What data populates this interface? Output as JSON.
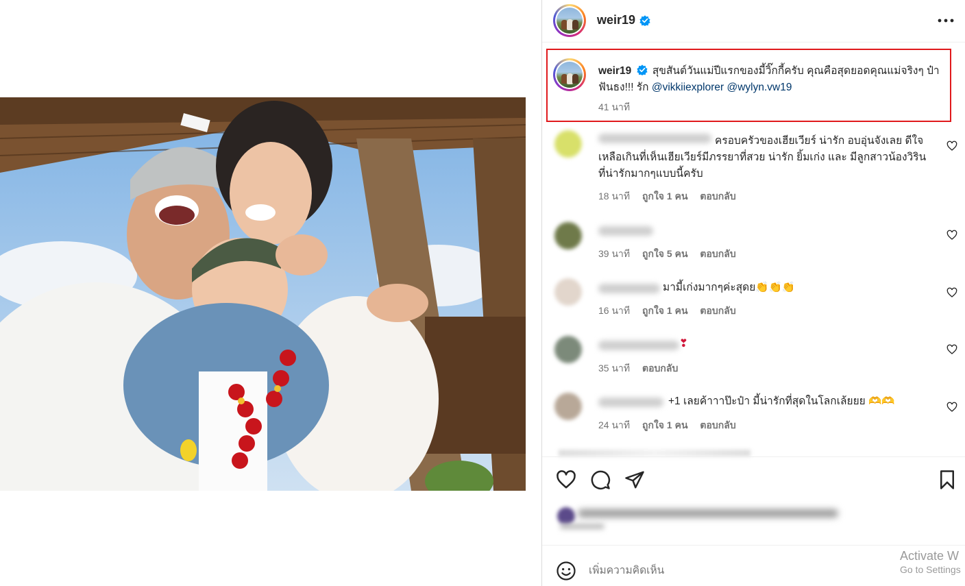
{
  "post": {
    "username": "weir19",
    "verified": true,
    "caption": {
      "username": "weir19",
      "text": "สุขสันต์วันแม่ปีแรกของมี้วิ๊กกี้ครับ คุณคือสุดยอดคุณแม่จริงๆ ป๋าฟันธง!!! รัก",
      "mentions": [
        "@vikkiiexplorer",
        "@wylyn.vw19"
      ],
      "time": "41 นาที"
    }
  },
  "comments": [
    {
      "text": "ครอบครัวของเฮียเวียร์ น่ารัก อบอุ่นจังเลย ดีใจเหลือเกินที่เห็นเฮียเวียร์มีภรรยาที่สวย น่ารัก ยิ้มเก่ง และ มีลูกสาวน้องวิริน ที่น่ารักมากๆแบบนี้ครับ",
      "time": "18 นาที",
      "likes": "ถูกใจ 1 คน",
      "reply": "ตอบกลับ"
    },
    {
      "text": "",
      "time": "39 นาที",
      "likes": "ถูกใจ 5 คน",
      "reply": "ตอบกลับ"
    },
    {
      "text": "มามี้เก่งมากๆค่ะสุดย👏👏👏",
      "time": "16 นาที",
      "likes": "ถูกใจ 1 คน",
      "reply": "ตอบกลับ"
    },
    {
      "text": "❣",
      "time": "35 นาที",
      "likes": "",
      "reply": "ตอบกลับ"
    },
    {
      "text": "+1 เลยค้าาาป๊ะป๋า มี้น่ารักที่สุดในโลกเล้ยยย 🫶🫶",
      "time": "24 นาที",
      "likes": "ถูกใจ 1 คน",
      "reply": "ตอบกลับ"
    }
  ],
  "add_comment": {
    "placeholder": "เพิ่มความคิดเห็น"
  },
  "watermark": {
    "title": "Activate W",
    "subtitle": "Go to Settings"
  },
  "icons": {
    "more": "more-options-icon",
    "verified": "verified-badge-icon",
    "like": "heart-icon",
    "comment": "comment-icon",
    "share": "share-icon",
    "save": "bookmark-icon",
    "emoji": "emoji-icon"
  },
  "colors": {
    "verified_blue": "#0095f6",
    "highlight_border": "#e0191c",
    "mention": "#00376b",
    "meta_grey": "#737373"
  }
}
